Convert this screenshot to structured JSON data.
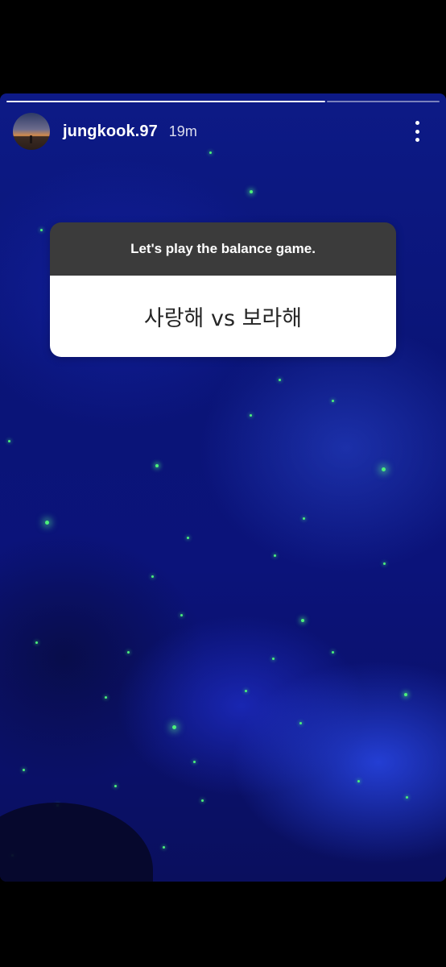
{
  "story": {
    "username": "jungkook.97",
    "time_ago": "19m",
    "progress": {
      "segments_total": 2,
      "segments_viewed": 1
    }
  },
  "question_sticker": {
    "prompt": "Let's play the balance game.",
    "answer": "사랑해 vs 보라해"
  },
  "icons": {
    "more": "more-vertical-icon",
    "avatar": "profile-avatar"
  },
  "colors": {
    "background": "#000000",
    "sky_blue": "#0d1a86",
    "star_green": "#4cf07a",
    "sticker_header": "#3b3b3b",
    "sticker_body": "#ffffff"
  }
}
